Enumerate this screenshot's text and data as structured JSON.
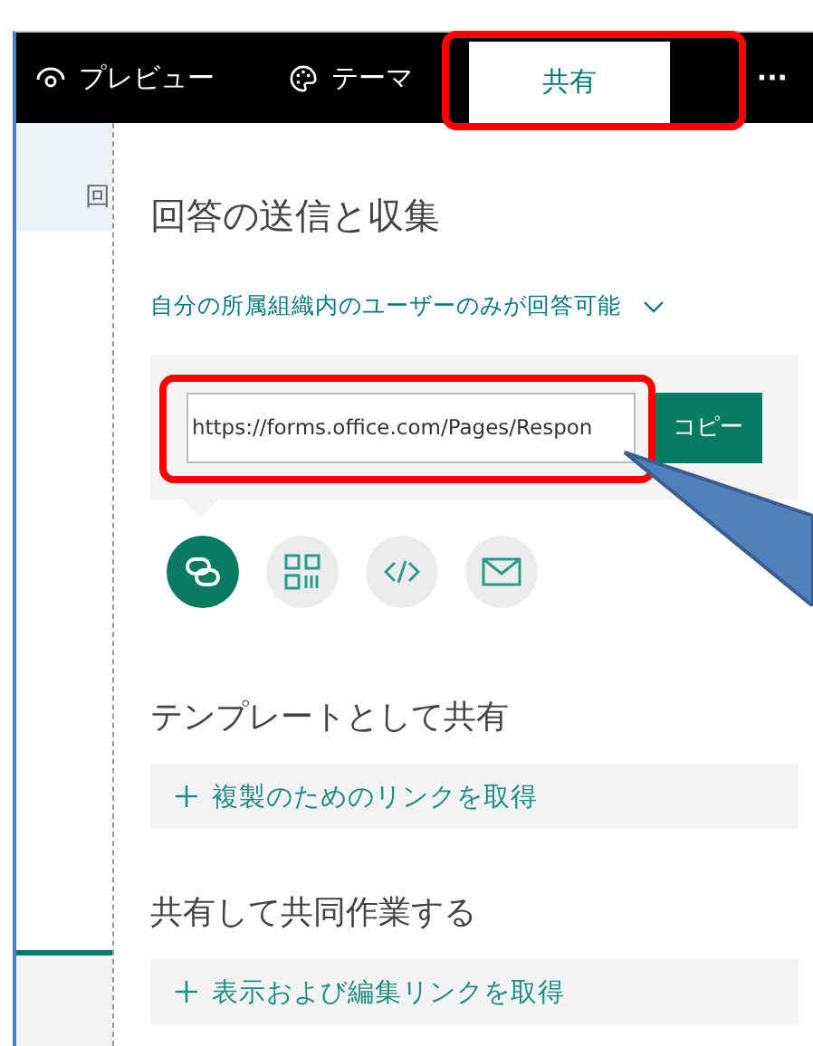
{
  "toolbar": {
    "tabs": [
      {
        "label": "プレビュー",
        "kind": "preview",
        "selected": false
      },
      {
        "label": "テーマ",
        "kind": "theme",
        "selected": false
      },
      {
        "label": "共有",
        "kind": "share",
        "selected": true
      }
    ],
    "more": "···"
  },
  "sidebar": {
    "partial_text": "回"
  },
  "share_panel": {
    "title": "回答の送信と収集",
    "audience": "自分の所属組織内のユーザーのみが回答可能",
    "link": {
      "value": "https://forms.office.com/Pages/Respon",
      "copy_button": "コピー"
    },
    "methods": [
      {
        "kind": "link",
        "selected": true
      },
      {
        "kind": "qr",
        "selected": false
      },
      {
        "kind": "embed",
        "selected": false
      },
      {
        "kind": "email",
        "selected": false
      }
    ],
    "sections": [
      {
        "heading": "テンプレートとして共有",
        "action": "複製のためのリンクを取得"
      },
      {
        "heading": "共有して共同作業する",
        "action": "表示および編集リンクを取得"
      }
    ]
  }
}
